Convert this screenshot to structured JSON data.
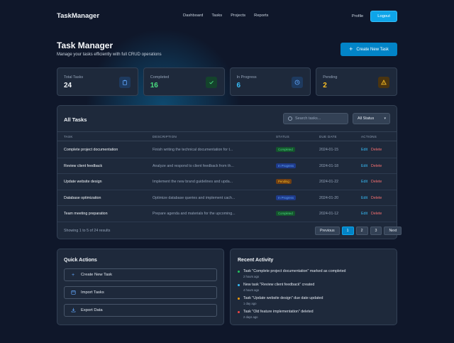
{
  "nav": {
    "brand": "TaskManager",
    "links": [
      "Dashboard",
      "Tasks",
      "Projects",
      "Reports"
    ],
    "profile": "Profile",
    "logout": "Logout"
  },
  "header": {
    "title": "Task Manager",
    "subtitle": "Manage your tasks efficiently with full CRUD operations",
    "create_button": "Create New Task"
  },
  "stats": [
    {
      "label": "Total Tasks",
      "value": "24",
      "icon": "clipboard-icon",
      "color": "#f1f5f9",
      "accent": "#60a5fa"
    },
    {
      "label": "Completed",
      "value": "16",
      "icon": "check-icon",
      "color": "#4ade80",
      "accent": "#4ade80"
    },
    {
      "label": "In Progress",
      "value": "6",
      "icon": "clock-icon",
      "color": "#38bdf8",
      "accent": "#60a5fa"
    },
    {
      "label": "Pending",
      "value": "2",
      "icon": "warning-icon",
      "color": "#fbbf24",
      "accent": "#fbbf24"
    }
  ],
  "tasks": {
    "title": "All Tasks",
    "search_placeholder": "Search tasks...",
    "filter_selected": "All Status",
    "columns": {
      "task": "TASK",
      "description": "DESCRIPTION",
      "status": "STATUS",
      "due_date": "DUE DATE",
      "actions": "ACTIONS"
    },
    "rows": [
      {
        "task": "Complete project documentation",
        "description": "Finish writing the technical documentation for t...",
        "status": "Completed",
        "status_key": "completed",
        "due": "2024-01-15"
      },
      {
        "task": "Review client feedback",
        "description": "Analyze and respond to client feedback from th...",
        "status": "In Progress",
        "status_key": "inprogress",
        "due": "2024-01-18"
      },
      {
        "task": "Update website design",
        "description": "Implement the new brand guidelines and upda...",
        "status": "Pending",
        "status_key": "pending",
        "due": "2024-01-22"
      },
      {
        "task": "Database optimization",
        "description": "Optimize database queries and implement cach...",
        "status": "In Progress",
        "status_key": "inprogress",
        "due": "2024-01-20"
      },
      {
        "task": "Team meeting preparation",
        "description": "Prepare agenda and materials for the upcoming...",
        "status": "Completed",
        "status_key": "completed",
        "due": "2024-01-12"
      }
    ],
    "edit_label": "Edit",
    "delete_label": "Delete",
    "showing": "Showing 1 to 5 of 24 results",
    "pagination": {
      "previous": "Previous",
      "pages": [
        "1",
        "2",
        "3"
      ],
      "active": "1",
      "next": "Next"
    }
  },
  "quick_actions": {
    "title": "Quick Actions",
    "items": [
      {
        "label": "Create New Task",
        "icon": "plus-icon"
      },
      {
        "label": "Import Tasks",
        "icon": "import-icon"
      },
      {
        "label": "Export Data",
        "icon": "export-icon"
      }
    ]
  },
  "recent_activity": {
    "title": "Recent Activity",
    "items": [
      {
        "text": "Task \"Complete project documentation\" marked as completed",
        "time": "2 hours ago",
        "color": "#22c55e"
      },
      {
        "text": "New task \"Review client feedback\" created",
        "time": "4 hours ago",
        "color": "#38bdf8"
      },
      {
        "text": "Task \"Update website design\" due date updated",
        "time": "1 day ago",
        "color": "#f59e0b"
      },
      {
        "text": "Task \"Old feature implementation\" deleted",
        "time": "2 days ago",
        "color": "#ef4444"
      }
    ]
  }
}
